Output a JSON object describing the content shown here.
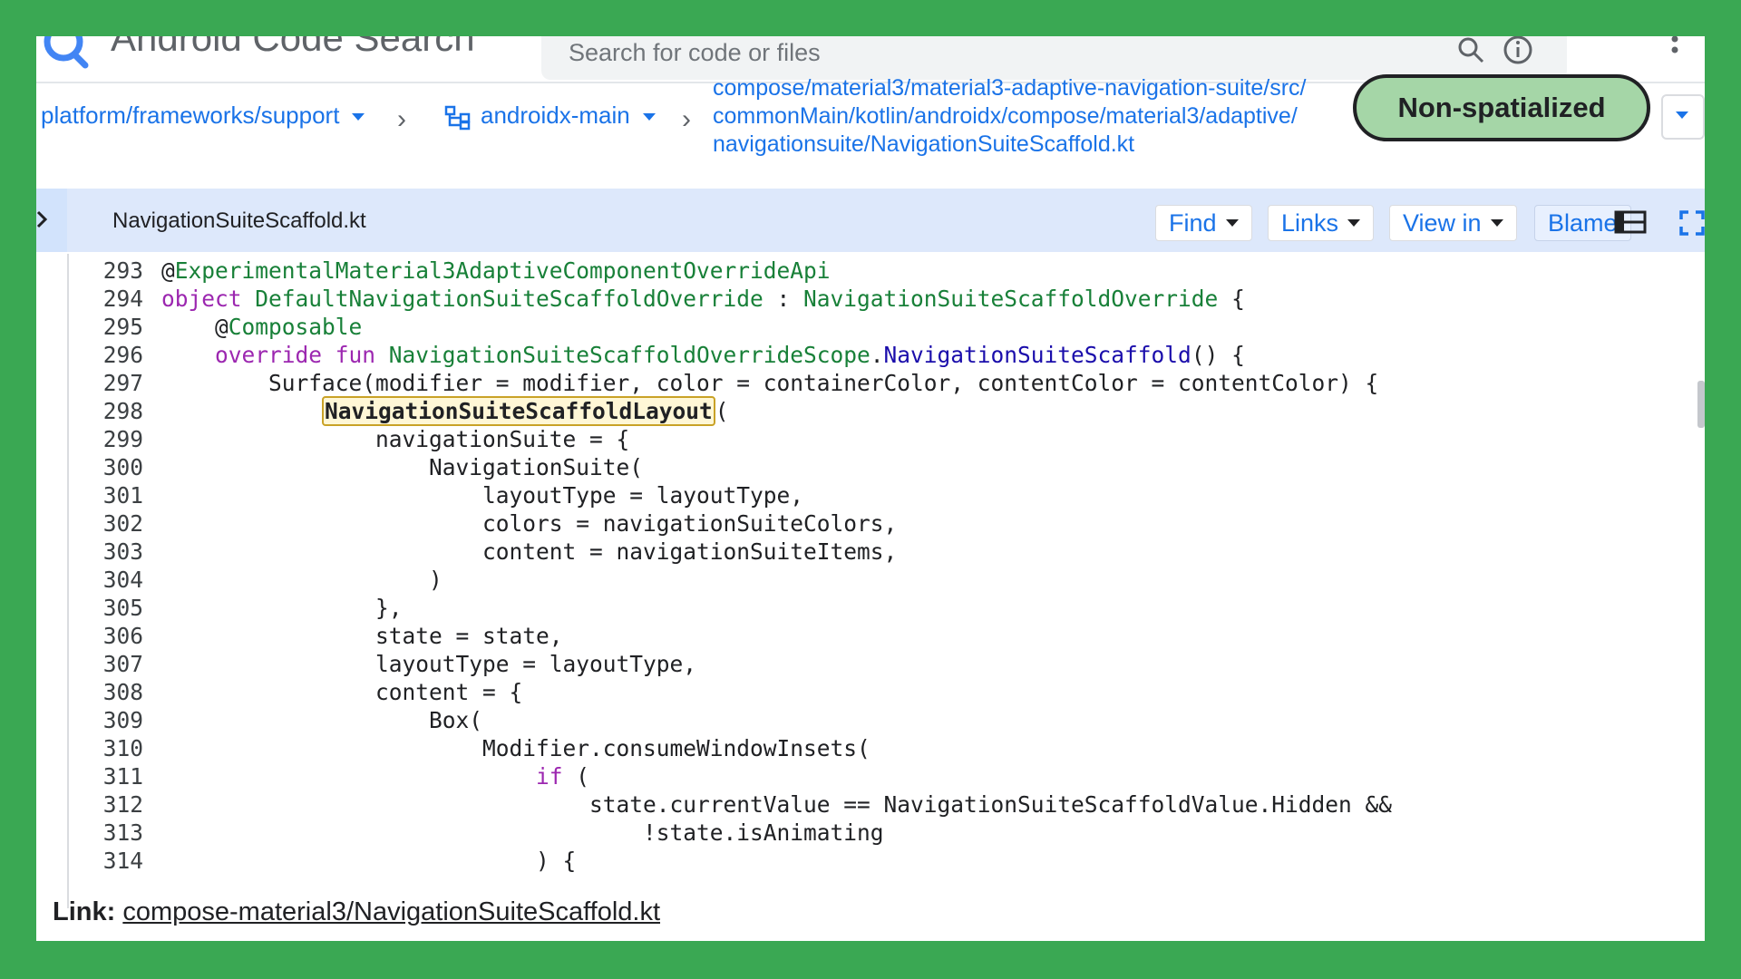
{
  "header": {
    "app_title": "Android Code Search",
    "search_placeholder": "Search for code or files"
  },
  "breadcrumb": {
    "repo": "platform/frameworks/support",
    "branch": "androidx-main",
    "path_lines": [
      "compose/material3/material3-adaptive-navigation-suite/src/",
      "commonMain/kotlin/androidx/compose/material3/adaptive/",
      "navigationsuite/NavigationSuiteScaffold.kt"
    ]
  },
  "badge": {
    "label": "Non-spatialized",
    "color": "#a5d6a7"
  },
  "file_header": {
    "filename": "NavigationSuiteScaffold.kt",
    "buttons": {
      "find": "Find",
      "links": "Links",
      "view_in": "View in",
      "blame": "Blame"
    }
  },
  "code": {
    "lines": [
      {
        "n": "293",
        "segs": [
          {
            "t": "@",
            "c": "#202124"
          },
          {
            "t": "ExperimentalMaterial3AdaptiveComponentOverrideApi",
            "c": "#188038"
          }
        ]
      },
      {
        "n": "294",
        "segs": [
          {
            "t": "object ",
            "c": "#9c27b0"
          },
          {
            "t": "DefaultNavigationSuiteScaffoldOverride",
            "c": "#188038"
          },
          {
            "t": " : ",
            "c": "#202124"
          },
          {
            "t": "NavigationSuiteScaffoldOverride",
            "c": "#188038"
          },
          {
            "t": " {",
            "c": "#202124"
          }
        ]
      },
      {
        "n": "295",
        "segs": [
          {
            "t": "    @",
            "c": "#202124"
          },
          {
            "t": "Composable",
            "c": "#188038"
          }
        ]
      },
      {
        "n": "296",
        "segs": [
          {
            "t": "    override fun ",
            "c": "#9c27b0"
          },
          {
            "t": "NavigationSuiteScaffoldOverrideScope",
            "c": "#188038"
          },
          {
            "t": ".",
            "c": "#202124"
          },
          {
            "t": "NavigationSuiteScaffold",
            "c": "#1a0dab"
          },
          {
            "t": "() {",
            "c": "#202124"
          }
        ]
      },
      {
        "n": "297",
        "segs": [
          {
            "t": "        Surface(modifier = modifier, color = containerColor, contentColor = contentColor) {",
            "c": "#202124"
          }
        ]
      },
      {
        "n": "298",
        "segs": [
          {
            "t": "            ",
            "c": "#202124"
          },
          {
            "t": "NavigationSuiteScaffoldLayout",
            "c": "#202124",
            "hl": true
          },
          {
            "t": "(",
            "c": "#202124"
          }
        ]
      },
      {
        "n": "299",
        "segs": [
          {
            "t": "                navigationSuite = {",
            "c": "#202124"
          }
        ]
      },
      {
        "n": "300",
        "segs": [
          {
            "t": "                    NavigationSuite(",
            "c": "#202124"
          }
        ]
      },
      {
        "n": "301",
        "segs": [
          {
            "t": "                        layoutType = layoutType,",
            "c": "#202124"
          }
        ]
      },
      {
        "n": "302",
        "segs": [
          {
            "t": "                        colors = navigationSuiteColors,",
            "c": "#202124"
          }
        ]
      },
      {
        "n": "303",
        "segs": [
          {
            "t": "                        content = navigationSuiteItems,",
            "c": "#202124"
          }
        ]
      },
      {
        "n": "304",
        "segs": [
          {
            "t": "                    )",
            "c": "#202124"
          }
        ]
      },
      {
        "n": "305",
        "segs": [
          {
            "t": "                },",
            "c": "#202124"
          }
        ]
      },
      {
        "n": "306",
        "segs": [
          {
            "t": "                state = state,",
            "c": "#202124"
          }
        ]
      },
      {
        "n": "307",
        "segs": [
          {
            "t": "                layoutType = layoutType,",
            "c": "#202124"
          }
        ]
      },
      {
        "n": "308",
        "segs": [
          {
            "t": "                content = {",
            "c": "#202124"
          }
        ]
      },
      {
        "n": "309",
        "segs": [
          {
            "t": "                    Box(",
            "c": "#202124"
          }
        ]
      },
      {
        "n": "310",
        "segs": [
          {
            "t": "                        Modifier.consumeWindowInsets(",
            "c": "#202124"
          }
        ]
      },
      {
        "n": "311",
        "segs": [
          {
            "t": "                            if",
            "c": "#9c27b0"
          },
          {
            "t": " (",
            "c": "#202124"
          }
        ]
      },
      {
        "n": "312",
        "segs": [
          {
            "t": "                                state.currentValue == NavigationSuiteScaffoldValue.Hidden &&",
            "c": "#202124"
          }
        ]
      },
      {
        "n": "313",
        "segs": [
          {
            "t": "                                    !state.isAnimating",
            "c": "#202124"
          }
        ]
      },
      {
        "n": "314",
        "segs": [
          {
            "t": "                            ) {",
            "c": "#202124"
          }
        ]
      }
    ]
  },
  "footer": {
    "label": "Link:",
    "link_text": "compose-material3/NavigationSuiteScaffold.kt"
  },
  "icons": [
    "search-icon",
    "info-icon",
    "more-vert-icon",
    "branch-icon",
    "collapse-arrow-icon",
    "layout-icon",
    "fullscreen-icon"
  ]
}
